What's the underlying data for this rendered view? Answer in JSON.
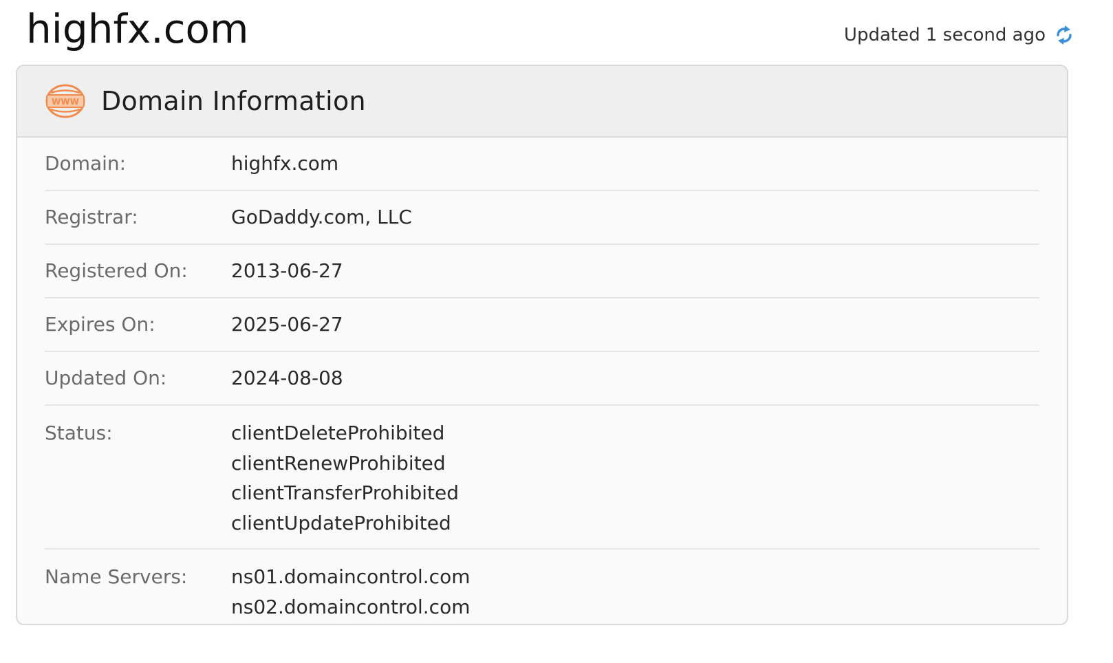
{
  "page_title": "highfx.com",
  "updated_text": "Updated 1 second ago",
  "card": {
    "title": "Domain Information",
    "icon": "www-icon"
  },
  "rows": {
    "domain": {
      "label": "Domain:",
      "value": "highfx.com"
    },
    "registrar": {
      "label": "Registrar:",
      "value": "GoDaddy.com, LLC"
    },
    "registered_on": {
      "label": "Registered On:",
      "value": "2013-06-27"
    },
    "expires_on": {
      "label": "Expires On:",
      "value": "2025-06-27"
    },
    "updated_on": {
      "label": "Updated On:",
      "value": "2024-08-08"
    },
    "status": {
      "label": "Status:",
      "values": [
        "clientDeleteProhibited",
        "clientRenewProhibited",
        "clientTransferProhibited",
        "clientUpdateProhibited"
      ]
    },
    "name_servers": {
      "label": "Name Servers:",
      "values": [
        "ns01.domaincontrol.com",
        "ns02.domaincontrol.com"
      ]
    }
  },
  "colors": {
    "accent_orange": "#f28a4b",
    "refresh_blue": "#3b8fd9",
    "header_bg": "#efefef",
    "border": "#d9d9d9"
  }
}
